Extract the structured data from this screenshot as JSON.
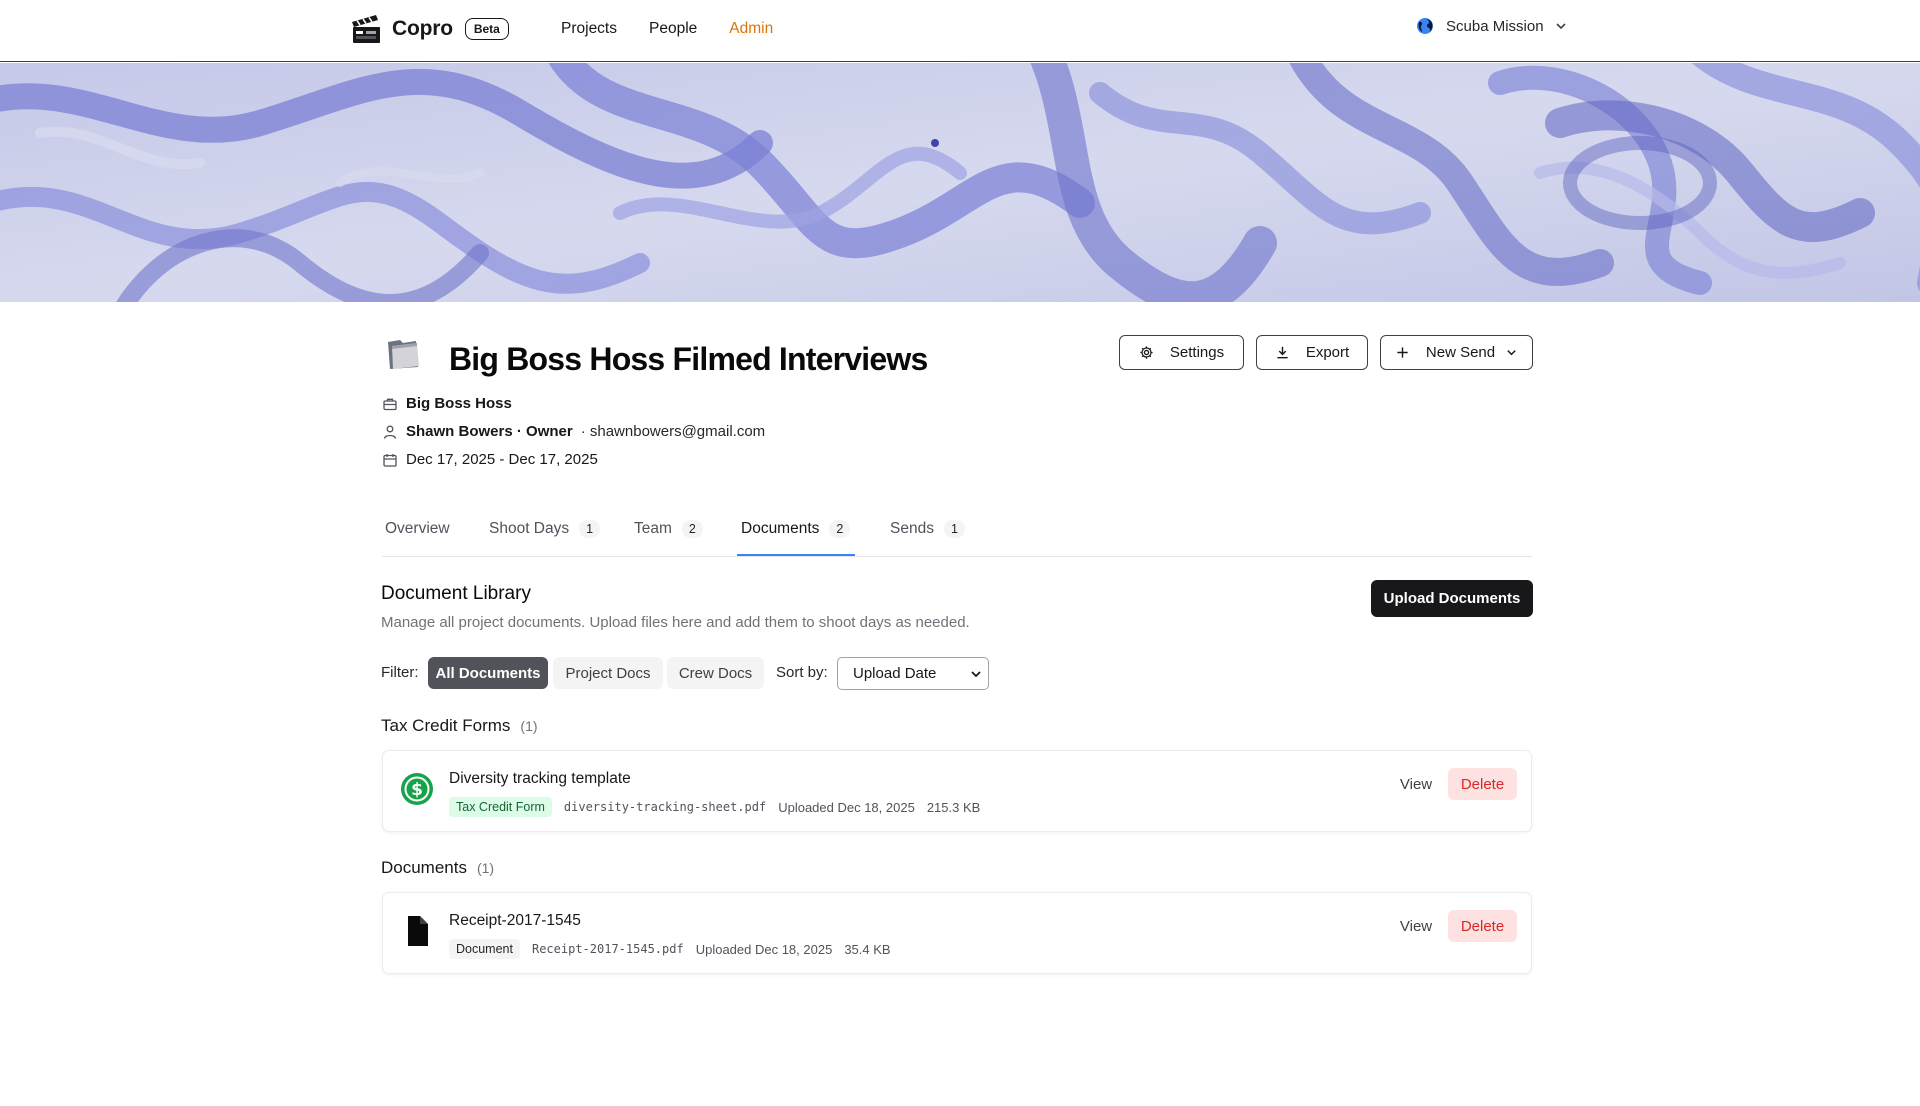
{
  "app": {
    "name": "Copro",
    "badge": "Beta"
  },
  "nav": {
    "projects": "Projects",
    "people": "People",
    "admin": "Admin"
  },
  "org": {
    "name": "Scuba Mission"
  },
  "project": {
    "title": "Big Boss Hoss Filmed Interviews",
    "company": "Big Boss Hoss",
    "owner": "Shawn Bowers · Owner",
    "email": "· shawnbowers@gmail.com",
    "dates": "Dec 17, 2025 - Dec 17, 2025"
  },
  "actions": {
    "settings": "Settings",
    "export": "Export",
    "new_send": "New Send"
  },
  "tabs": [
    {
      "label": "Overview",
      "count": ""
    },
    {
      "label": "Shoot Days",
      "count": "1"
    },
    {
      "label": "Team",
      "count": "2"
    },
    {
      "label": "Documents",
      "count": "2"
    },
    {
      "label": "Sends",
      "count": "1"
    }
  ],
  "active_tab": "Documents",
  "library": {
    "title": "Document Library",
    "subtitle": "Manage all project documents. Upload files here and add them to shoot days as needed.",
    "upload_label": "Upload Documents",
    "filter_label": "Filter:",
    "filters": [
      "All Documents",
      "Project Docs",
      "Crew Docs"
    ],
    "active_filter": "All Documents",
    "sort_label": "Sort by:",
    "sort_value": "Upload Date"
  },
  "groups": [
    {
      "title": "Tax Credit Forms",
      "count": "(1)",
      "items": [
        {
          "name": "Diversity tracking template",
          "tag": "Tax Credit Form",
          "filename": "diversity-tracking-sheet.pdf",
          "uploaded": "Uploaded Dec 18, 2025",
          "size": "215.3 KB",
          "icon": "dollar-circle-icon"
        }
      ]
    },
    {
      "title": "Documents",
      "count": "(1)",
      "items": [
        {
          "name": "Receipt-2017-1545",
          "tag": "Document",
          "filename": "Receipt-2017-1545.pdf",
          "uploaded": "Uploaded Dec 18, 2025",
          "size": "35.4 KB",
          "icon": "file-icon"
        }
      ]
    }
  ],
  "row_actions": {
    "view": "View",
    "delete": "Delete"
  },
  "colors": {
    "accent": "#3b82f6",
    "admin": "#d97706",
    "danger": "#dc2626",
    "success": "#16a34a"
  }
}
